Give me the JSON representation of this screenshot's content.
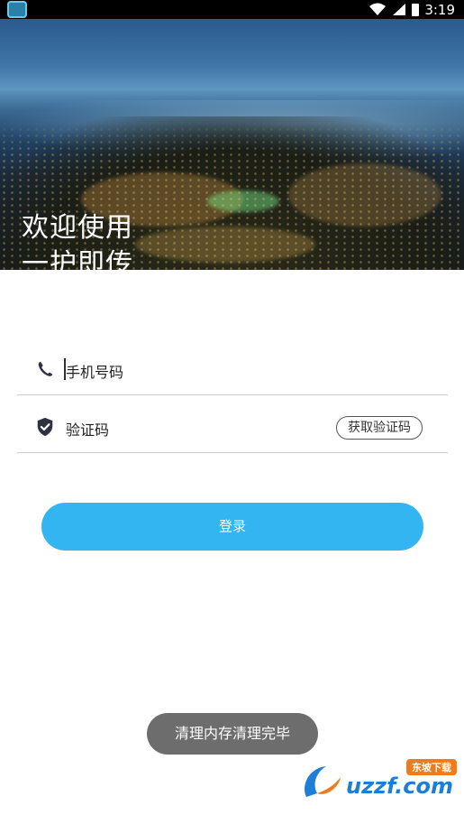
{
  "status_bar": {
    "time": "3:19",
    "app_icon": "app-notification-icon",
    "wifi_icon": "wifi-icon",
    "signal_icon": "signal-icon",
    "battery_icon": "battery-icon"
  },
  "hero": {
    "title_line1": "欢迎使用",
    "title_line2": "一护即传"
  },
  "form": {
    "phone": {
      "icon": "phone-icon",
      "placeholder": "手机号码"
    },
    "code": {
      "icon": "shield-check-icon",
      "placeholder": "验证码",
      "get_code_label": "获取验证码"
    },
    "login_label": "登录"
  },
  "toast": {
    "text": "清理内存清理完毕"
  },
  "watermark": {
    "text": "uzzf.com",
    "badge": "东坡下载"
  },
  "colors": {
    "accent": "#33b5f2",
    "toast_bg": "#6d6d6d",
    "divider": "#cfcfcf"
  }
}
